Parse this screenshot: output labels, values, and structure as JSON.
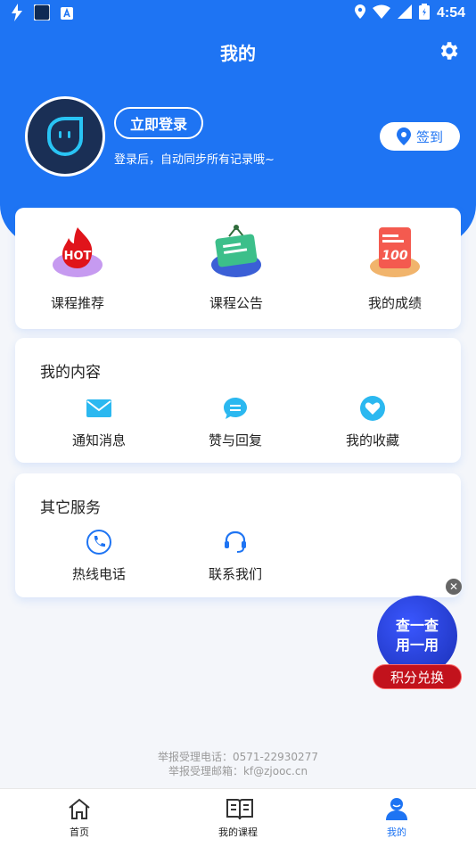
{
  "status_bar": {
    "time": "4:54"
  },
  "header": {
    "title": "我的"
  },
  "profile": {
    "login_label": "立即登录",
    "login_tip": "登录后，自动同步所有记录哦~",
    "checkin_label": "签到"
  },
  "shortcuts": [
    {
      "label": "课程推荐",
      "badge": "HOT"
    },
    {
      "label": "课程公告"
    },
    {
      "label": "我的成绩",
      "badge": "100"
    }
  ],
  "my_content": {
    "title": "我的内容",
    "items": [
      {
        "label": "通知消息"
      },
      {
        "label": "赞与回复"
      },
      {
        "label": "我的收藏"
      }
    ]
  },
  "other_services": {
    "title": "其它服务",
    "items": [
      {
        "label": "热线电话"
      },
      {
        "label": "联系我们"
      }
    ]
  },
  "float_widget": {
    "line1": "查一查",
    "line2": "用一用",
    "redeem_label": "积分兑换"
  },
  "footer": {
    "phone": "举报受理电话：0571-22930277",
    "email": "举报受理邮箱：kf@zjooc.cn"
  },
  "tabs": [
    {
      "label": "首页"
    },
    {
      "label": "我的课程"
    },
    {
      "label": "我的",
      "active": true
    }
  ],
  "colors": {
    "primary": "#1e74f3",
    "hot_red": "#e0141b",
    "redeem": "#c2121c"
  }
}
